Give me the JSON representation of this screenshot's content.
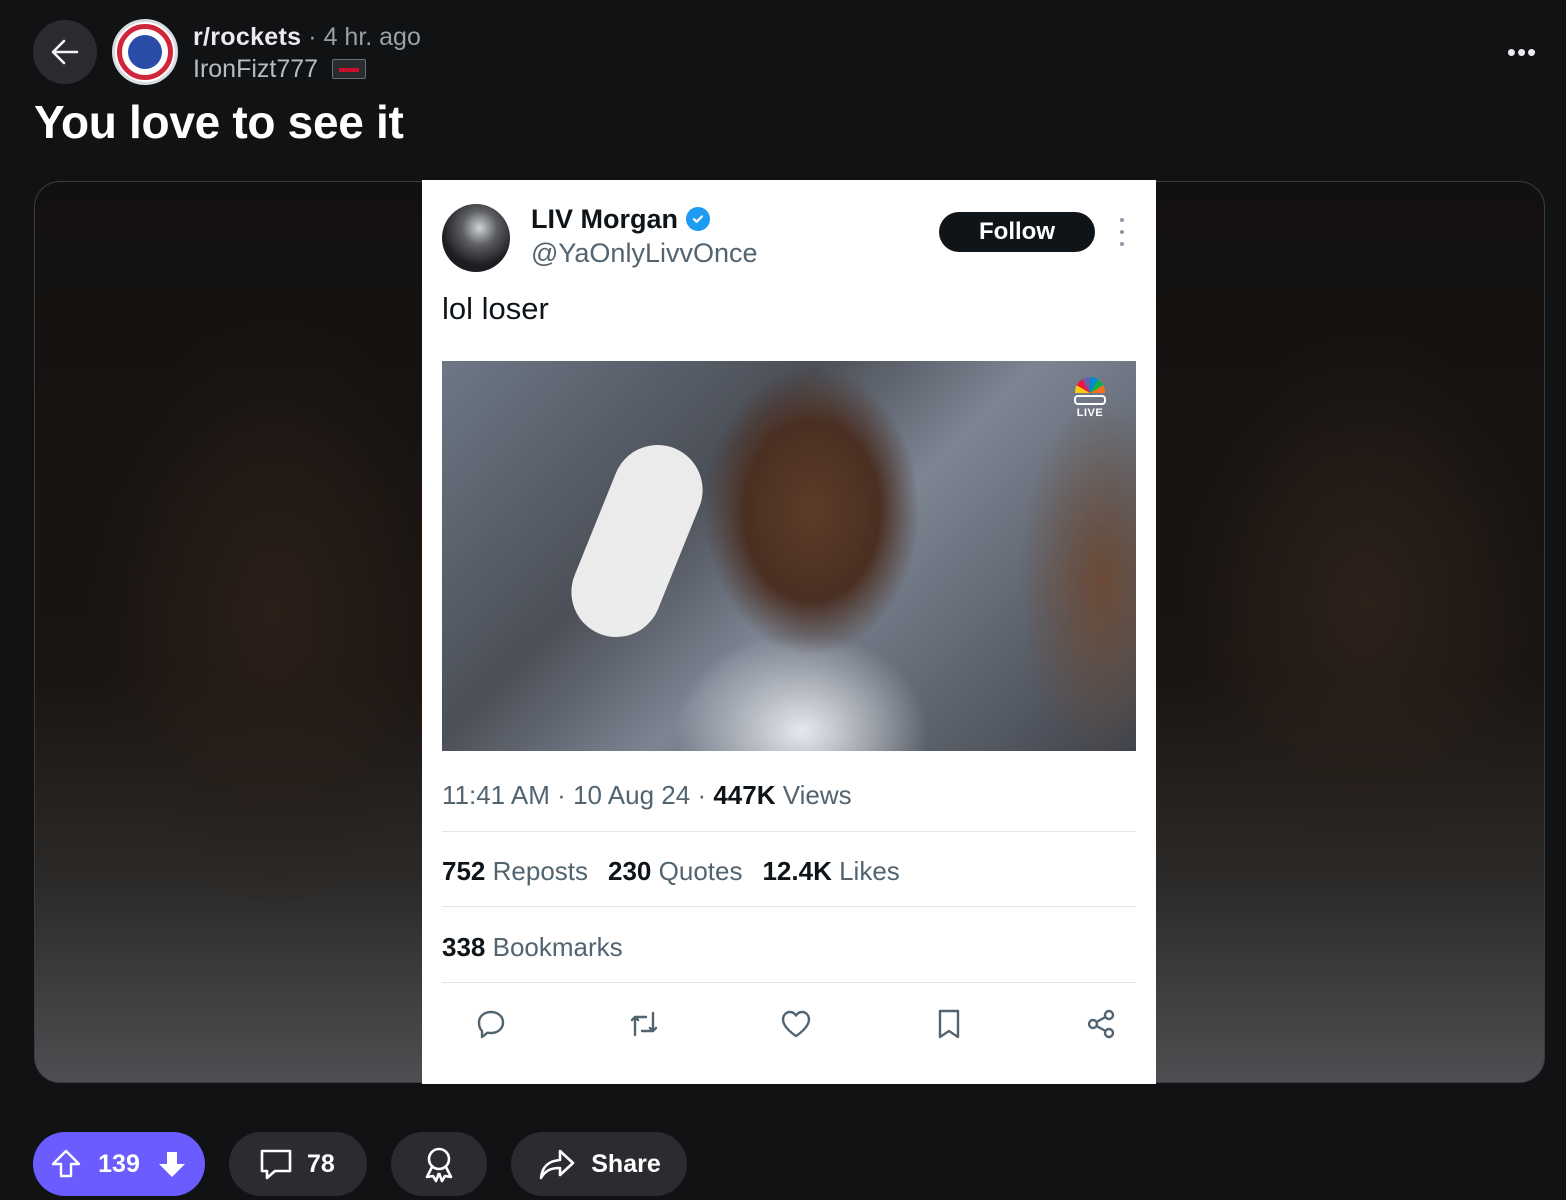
{
  "header": {
    "subreddit": "r/rockets",
    "separator": "·",
    "age": "4 hr. ago",
    "author": "IronFizt777",
    "overflow_label": "•••"
  },
  "post": {
    "title": "You love to see it"
  },
  "tweet": {
    "name": "LIV Morgan",
    "handle": "@YaOnlyLivvOnce",
    "follow_label": "Follow",
    "text": "lol loser",
    "live_label": "LIVE",
    "time": "11:41 AM",
    "date": "10 Aug 24",
    "sep": "·",
    "views_count": "447K",
    "views_label": "Views",
    "reposts_count": "752",
    "reposts_label": "Reposts",
    "quotes_count": "230",
    "quotes_label": "Quotes",
    "likes_count": "12.4K",
    "likes_label": "Likes",
    "bookmarks_count": "338",
    "bookmarks_label": "Bookmarks"
  },
  "actions": {
    "vote_count": "139",
    "comment_count": "78",
    "share_label": "Share"
  },
  "colors": {
    "background": "#111214",
    "vote_accent": "#6a5cff",
    "pill_bg": "#2a2c30",
    "verified": "#1d9bf0"
  },
  "icons": [
    "back-arrow-icon",
    "upvote-icon",
    "downvote-icon",
    "comment-icon",
    "award-icon",
    "share-icon",
    "verified-icon",
    "reply-icon",
    "repost-icon",
    "like-icon",
    "bookmark-icon",
    "share-nodes-icon"
  ]
}
